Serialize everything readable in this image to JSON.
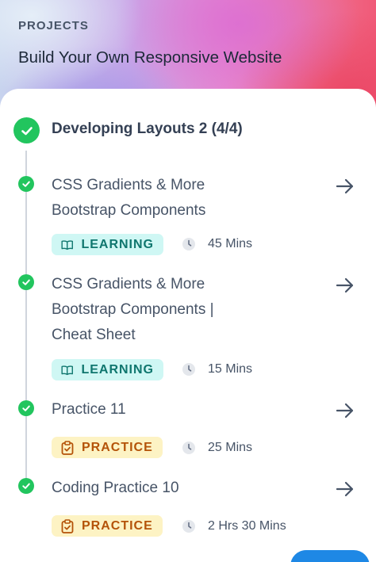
{
  "header": {
    "eyebrow": "PROJECTS",
    "title": "Build Your Own Responsive Website"
  },
  "section": {
    "title": "Developing Layouts 2 (4/4)",
    "status": "completed"
  },
  "items": [
    {
      "title_lines": [
        "CSS Gradients & More",
        "Bootstrap Components"
      ],
      "badge": "LEARNING",
      "badge_type": "learning",
      "duration": "45 Mins",
      "status": "completed"
    },
    {
      "title_lines": [
        "CSS Gradients & More",
        "Bootstrap Components |",
        "Cheat Sheet"
      ],
      "badge": "LEARNING",
      "badge_type": "learning",
      "duration": "15 Mins",
      "status": "completed"
    },
    {
      "title_lines": [
        "Practice 11"
      ],
      "badge": "PRACTICE",
      "badge_type": "practice",
      "duration": "25 Mins",
      "status": "completed"
    },
    {
      "title_lines": [
        "Coding Practice 10"
      ],
      "badge": "PRACTICE",
      "badge_type": "practice",
      "duration": "2 Hrs 30 Mins",
      "status": "completed"
    }
  ],
  "icons": {
    "check": "check-icon",
    "arrow": "arrow-right-icon",
    "learning": "book-open-icon",
    "practice": "clipboard-check-icon",
    "clock": "clock-icon"
  },
  "colors": {
    "success": "#22c55e",
    "learning_bg": "#cff7f4",
    "learning_text": "#0f766e",
    "practice_bg": "#fdf3c4",
    "practice_text": "#b45309",
    "fab": "#1e88e5"
  }
}
